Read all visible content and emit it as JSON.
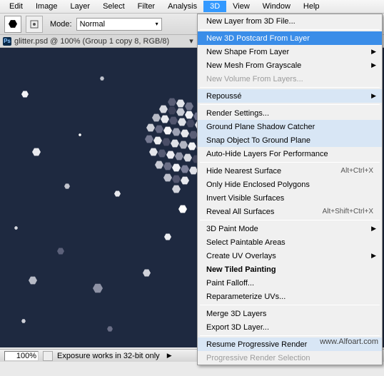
{
  "menubar": {
    "items": [
      "Edit",
      "Image",
      "Layer",
      "Select",
      "Filter",
      "Analysis",
      "3D",
      "View",
      "Window",
      "Help"
    ],
    "active_index": 6
  },
  "toolbar": {
    "brush_size": "14",
    "mode_label": "Mode:",
    "mode_value": "Normal"
  },
  "tab": {
    "ps": "Ps",
    "title": "glitter.psd @ 100% (Group 1 copy 8, RGB/8)"
  },
  "statusbar": {
    "zoom": "100%",
    "message": "Exposure works in 32-bit only"
  },
  "watermark": "www.Alfoart.com",
  "menu": {
    "new_layer": "New Layer from 3D File...",
    "new_postcard": "New 3D Postcard From Layer",
    "new_shape": "New Shape From Layer",
    "new_mesh": "New Mesh From Grayscale",
    "new_volume": "New Volume From Layers...",
    "repousse": "Repoussé",
    "render_settings": "Render Settings...",
    "ground_catcher": "Ground Plane Shadow Catcher",
    "snap_object": "Snap Object To Ground Plane",
    "auto_hide": "Auto-Hide Layers For Performance",
    "hide_nearest": "Hide Nearest Surface",
    "hide_nearest_sc": "Alt+Ctrl+X",
    "only_hide": "Only Hide Enclosed Polygons",
    "invert_visible": "Invert Visible Surfaces",
    "reveal_all": "Reveal All Surfaces",
    "reveal_all_sc": "Alt+Shift+Ctrl+X",
    "paint_mode": "3D Paint Mode",
    "select_paintable": "Select Paintable Areas",
    "create_uv": "Create UV Overlays",
    "tiled": "New Tiled Painting",
    "falloff": "Paint Falloff...",
    "reparam": "Reparameterize UVs...",
    "merge": "Merge 3D Layers",
    "export": "Export 3D Layer...",
    "resume": "Resume Progressive Render",
    "prog_sel": "Progressive Render Selection"
  }
}
